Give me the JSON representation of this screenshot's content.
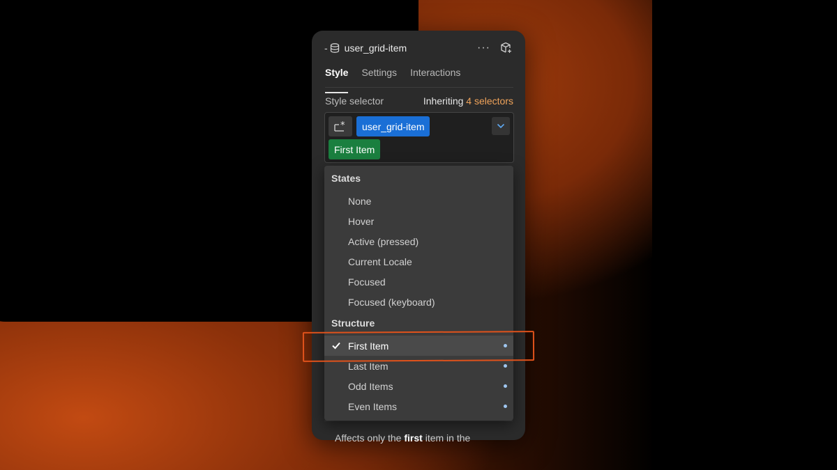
{
  "header": {
    "dash": "-",
    "title": "user_grid-item",
    "more_label": "···",
    "icons": {
      "db": "database-icon",
      "more": "more-icon",
      "cube": "component-icon"
    }
  },
  "tabs": [
    {
      "label": "Style",
      "active": true
    },
    {
      "label": "Settings",
      "active": false
    },
    {
      "label": "Interactions",
      "active": false
    }
  ],
  "style_selector": {
    "label": "Style selector",
    "inherit_prefix": "Inheriting",
    "inherit_count": "4 selectors",
    "chips": {
      "class": "user_grid-item",
      "state": "First Item"
    },
    "colors": {
      "class_chip": "#1a6fd6",
      "state_chip": "#1a7f3f",
      "accent": "#f0a35a"
    }
  },
  "menu": {
    "states_heading": "States",
    "states": [
      "None",
      "Hover",
      "Active (pressed)",
      "Current Locale",
      "Focused",
      "Focused (keyboard)"
    ],
    "structure_heading": "Structure",
    "structure": [
      {
        "label": "First Item",
        "selected": true
      },
      {
        "label": "Last Item",
        "selected": false
      },
      {
        "label": "Odd Items",
        "selected": false
      },
      {
        "label": "Even Items",
        "selected": false
      }
    ]
  },
  "footer": {
    "prefix": "Affects only the",
    "bold": "first",
    "suffix": "item in the"
  }
}
